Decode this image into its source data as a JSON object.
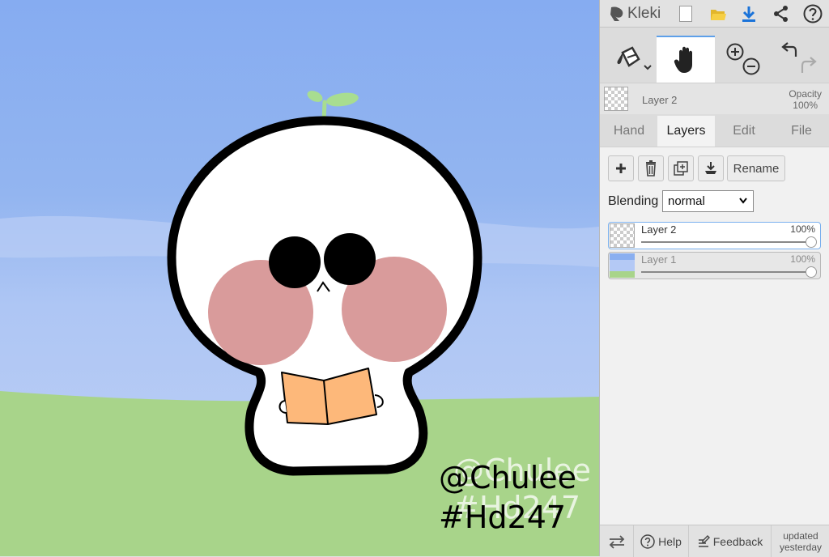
{
  "app": {
    "name": "Kleki"
  },
  "canvas": {
    "watermark_line1": "@Chulee",
    "watermark_line2": "#Hd247",
    "sky_color": "#8aaff0",
    "ground_color": "#a8d48a",
    "book_color": "#fdb87a",
    "blush_color": "#d99b9b",
    "sprout_color": "#a8dd90"
  },
  "topbar": {
    "icons": [
      "kleki-logo-icon",
      "new-image-icon",
      "open-folder-icon",
      "download-icon",
      "share-icon",
      "help-icon"
    ]
  },
  "tools": [
    "fill-tool-icon",
    "hand-tool-icon",
    "zoom-in-icon",
    "zoom-out-icon",
    "undo-icon",
    "redo-icon"
  ],
  "active_layer": {
    "name": "Layer 2",
    "opacity_label": "Opacity",
    "opacity_value": "100%"
  },
  "tabs": [
    {
      "label": "Hand",
      "active": false
    },
    {
      "label": "Layers",
      "active": true
    },
    {
      "label": "Edit",
      "active": false
    },
    {
      "label": "File",
      "active": false
    }
  ],
  "layers_panel": {
    "rename_label": "Rename",
    "blending_label": "Blending",
    "blending_value": "normal",
    "layers": [
      {
        "name": "Layer 2",
        "opacity": "100%",
        "selected": true
      },
      {
        "name": "Layer 1",
        "opacity": "100%",
        "selected": false
      }
    ]
  },
  "bottombar": {
    "help_label": "Help",
    "feedback_label": "Feedback",
    "updated_line1": "updated",
    "updated_line2": "yesterday"
  },
  "accent_color": "#5ea0e9"
}
